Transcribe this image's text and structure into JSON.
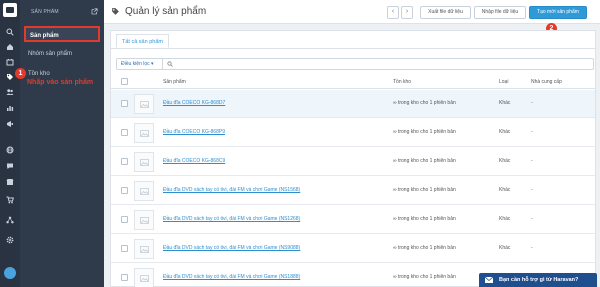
{
  "sidebar": {
    "section_title": "SẢN PHẨM",
    "items": [
      {
        "label": "Sản phẩm",
        "active": true
      },
      {
        "label": "Nhóm sản phẩm",
        "active": false
      },
      {
        "label": "Tồn kho",
        "active": false
      }
    ]
  },
  "rail_icons": [
    "search-icon",
    "home-icon",
    "orders-icon",
    "products-icon",
    "customers-icon",
    "reports-icon",
    "promotions-icon",
    "globe-icon",
    "chat-icon",
    "store-icon",
    "network-icon",
    "settings-icon"
  ],
  "annotations": {
    "step1_number": "1",
    "step1_text": "Nhấp vào sản phẩm",
    "step2_number": "2"
  },
  "header": {
    "title": "Quản lý sản phẩm",
    "export_label": "Xuất file dữ liệu",
    "import_label": "Nhập file dữ liệu",
    "create_label": "Tạo mới sản phẩm",
    "prev_symbol": "‹",
    "next_symbol": "›"
  },
  "tabs": [
    {
      "label": "Tất cả sản phẩm"
    }
  ],
  "filter": {
    "condition_label": "Điều kiện lọc ▾",
    "search_placeholder": ""
  },
  "table": {
    "columns": [
      "Sản phẩm",
      "Tồn kho",
      "Loại",
      "Nhà cung cấp"
    ],
    "rows": [
      {
        "name": "Đầu đĩa COECO KG-868D7",
        "stock": "∞ trong kho cho 1 phiên bản",
        "type": "Khác",
        "vendor": "-"
      },
      {
        "name": "Đầu đĩa COECO KG-868P9",
        "stock": "∞ trong kho cho 1 phiên bản",
        "type": "Khác",
        "vendor": "-"
      },
      {
        "name": "Đầu đĩa COECO KG-868C9",
        "stock": "∞ trong kho cho 1 phiên bản",
        "type": "Khác",
        "vendor": "-"
      },
      {
        "name": "Đầu đĩa DVD xách tay có tivi, đài FM và chơi Game (NS1568)",
        "stock": "∞ trong kho cho 1 phiên bản",
        "type": "Khác",
        "vendor": "-"
      },
      {
        "name": "Đầu đĩa DVD xách tay có tivi, đài FM và chơi Game (NS1268)",
        "stock": "∞ trong kho cho 1 phiên bản",
        "type": "Khác",
        "vendor": "-"
      },
      {
        "name": "Đầu đĩa DVD xách tay có tivi, đài FM và chơi Game (NS9088)",
        "stock": "∞ trong kho cho 1 phiên bản",
        "type": "Khác",
        "vendor": "-"
      },
      {
        "name": "Đầu đĩa DVD xách tay có tivi, đài FM và chơi Game (NS1888)",
        "stock": "∞ trong kho cho 1 phiên bản",
        "type": "Khác",
        "vendor": "-"
      }
    ]
  },
  "chat": {
    "label": "Bạn cần hỗ trợ gì từ Haravan?"
  },
  "colors": {
    "accent": "#2e9ad8",
    "callout": "#e23b2e",
    "sidebar": "#2f3a4a",
    "rail": "#2a3341"
  }
}
